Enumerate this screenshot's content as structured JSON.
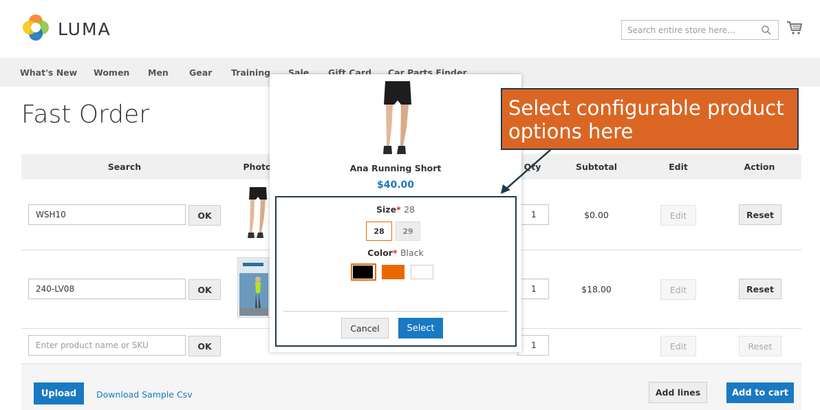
{
  "brand": {
    "name": "LUMA"
  },
  "search": {
    "placeholder": "Search entire store here..."
  },
  "nav": {
    "items": [
      "What's New",
      "Women",
      "Men",
      "Gear",
      "Training",
      "Sale",
      "Gift Card",
      "Car Parts Finder"
    ]
  },
  "page": {
    "title": "Fast Order"
  },
  "table": {
    "headers": {
      "search": "Search",
      "photo": "Photo",
      "qty": "Qty",
      "subtotal": "Subtotal",
      "edit": "Edit",
      "action": "Action"
    },
    "rows": [
      {
        "sku": "WSH10",
        "ok": "OK",
        "qty": "1",
        "subtotal": "$0.00",
        "edit": "Edit",
        "action": "Reset"
      },
      {
        "sku": "240-LV08",
        "ok": "OK",
        "qty": "1",
        "subtotal": "$18.00",
        "edit": "Edit",
        "action": "Reset"
      },
      {
        "sku": "",
        "sku_placeholder": "Enter product name or SKU",
        "ok": "OK",
        "qty": "1",
        "subtotal": "",
        "edit": "Edit",
        "action": "Reset"
      }
    ]
  },
  "footer": {
    "upload": "Upload",
    "download": "Download Sample Csv",
    "add_lines": "Add lines",
    "add_to_cart": "Add to cart"
  },
  "popup": {
    "product_name": "Ana Running Short",
    "price": "$40.00",
    "size": {
      "label": "Size",
      "required": "*",
      "selected": "28",
      "options": [
        "28",
        "29"
      ]
    },
    "color": {
      "label": "Color",
      "required": "*",
      "selected": "Black",
      "swatches": [
        "#000000",
        "#eb6703",
        "#ffffff"
      ]
    },
    "cancel": "Cancel",
    "select": "Select"
  },
  "callout": {
    "text": "Select configurable product options here"
  },
  "colors": {
    "accent": "#1979c3",
    "callout": "#db6624",
    "border_dark": "#223b4c"
  }
}
